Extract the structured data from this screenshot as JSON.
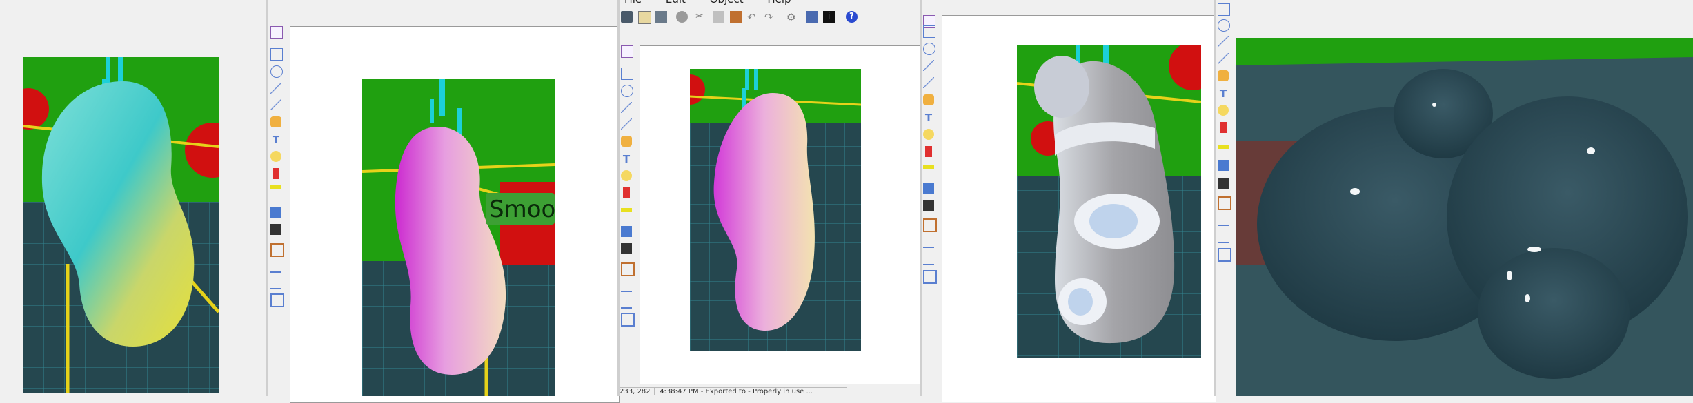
{
  "menu": {
    "items": [
      {
        "label": "File"
      },
      {
        "label": "Edit"
      },
      {
        "label": "Object"
      },
      {
        "label": "Help"
      }
    ]
  },
  "toolbar_icons": [
    "save-icon",
    "paste-icon",
    "print-icon",
    "delete-icon",
    "cut-icon",
    "copy-icon",
    "paste-special-icon",
    "undo-icon",
    "redo-icon",
    "settings-icon",
    "properties-icon",
    "info-icon",
    "help-icon"
  ],
  "tools": [
    "select-tool",
    "rectangle-tool",
    "ellipse-tool",
    "line-tool",
    "connector-tool",
    "paint-tool",
    "text-tool",
    "callout-tool",
    "badge-tool",
    "highlighter-tool",
    "image-tool",
    "stamp-tool",
    "crop-tool",
    "rotate-tool",
    "skew-tool",
    "zoom-fit-tool"
  ],
  "panels": {
    "panel2": {
      "overlay_text": "Smoo"
    }
  },
  "status": {
    "coords": "233, 282",
    "message": "4:38:47 PM - Exported to - Properly in use ..."
  },
  "colors": {
    "green_bg": "#1a9e10",
    "floor": "#2a4a52",
    "cyan_grid": "#3fc5d4",
    "yellow": "#e6d21a",
    "red": "#d11010",
    "ui_bg": "#f0f0f0"
  }
}
